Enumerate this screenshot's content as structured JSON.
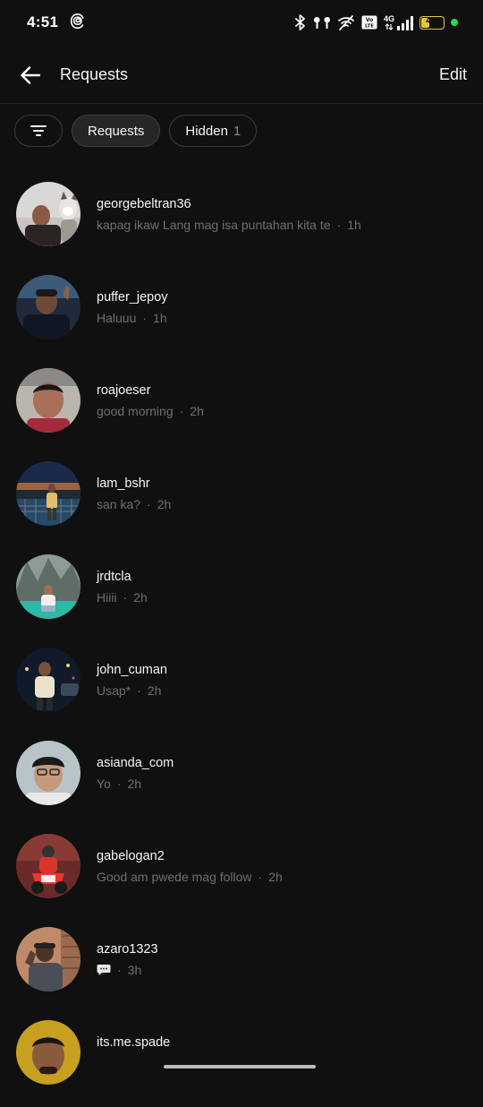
{
  "status_bar": {
    "time": "4:51",
    "network": "4G",
    "volte": "Vo LTE",
    "battery_level": "44",
    "battery_percent": 44
  },
  "header": {
    "title": "Requests",
    "edit_label": "Edit"
  },
  "chips": {
    "filter_icon": "filter-lines-icon",
    "requests_label": "Requests",
    "hidden_label": "Hidden",
    "hidden_count": "1"
  },
  "requests": [
    {
      "username": "georgebeltran36",
      "message": "kapag ikaw Lang mag isa puntahan kita te",
      "time": "1h"
    },
    {
      "username": "puffer_jepoy",
      "message": "Haluuu",
      "time": "1h"
    },
    {
      "username": "roajoeser",
      "message": "good morning",
      "time": "2h"
    },
    {
      "username": "lam_bshr",
      "message": "san ka?",
      "time": "2h"
    },
    {
      "username": "jrdtcla",
      "message": "Hiiii",
      "time": "2h"
    },
    {
      "username": "john_cuman",
      "message": "Usap*",
      "time": "2h"
    },
    {
      "username": "asianda_com",
      "message": "Yo",
      "time": "2h"
    },
    {
      "username": "gabelogan2",
      "message": "Good am pwede mag follow",
      "time": "2h"
    },
    {
      "username": "azaro1323",
      "message": "",
      "message_icon": "speech-bubble-icon",
      "time": "3h"
    },
    {
      "username": "its.me.spade",
      "message": "",
      "time": ""
    }
  ]
}
